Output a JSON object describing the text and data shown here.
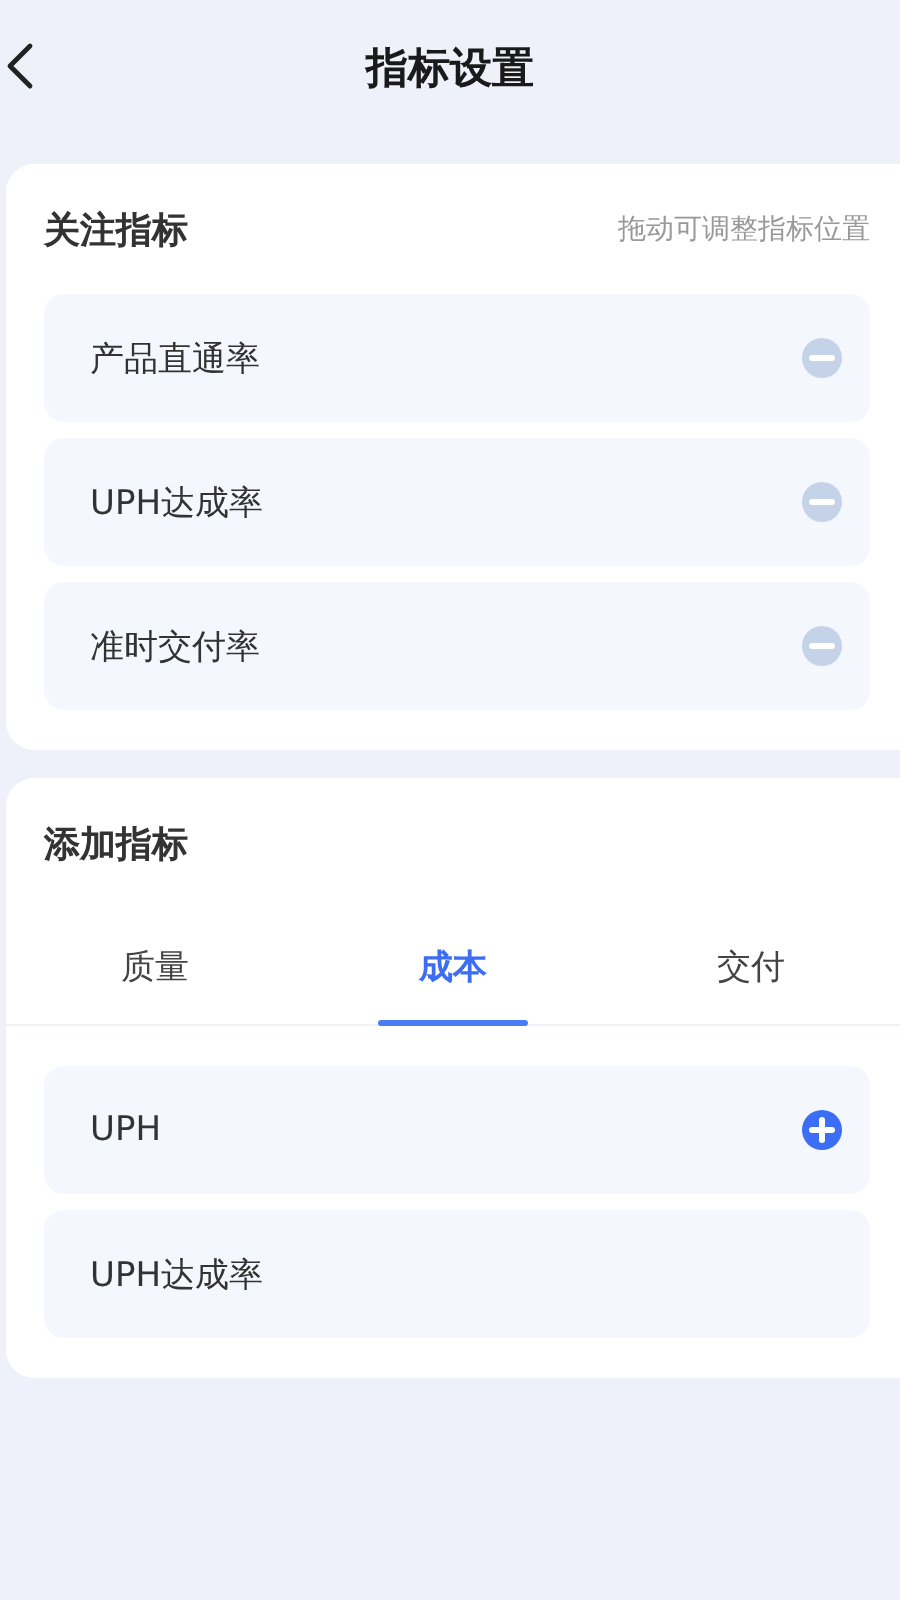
{
  "header": {
    "title": "指标设置"
  },
  "followed": {
    "title": "关注指标",
    "hint": "拖动可调整指标位置",
    "items": [
      {
        "label": "产品直通率"
      },
      {
        "label": "UPH达成率"
      },
      {
        "label": "准时交付率"
      }
    ]
  },
  "add": {
    "title": "添加指标",
    "tabs": [
      {
        "label": "质量",
        "selected": false
      },
      {
        "label": "成本",
        "selected": true
      },
      {
        "label": "交付",
        "selected": false
      }
    ],
    "items": [
      {
        "label": "UPH",
        "added": false
      },
      {
        "label": "UPH达成率",
        "added": true
      }
    ]
  }
}
